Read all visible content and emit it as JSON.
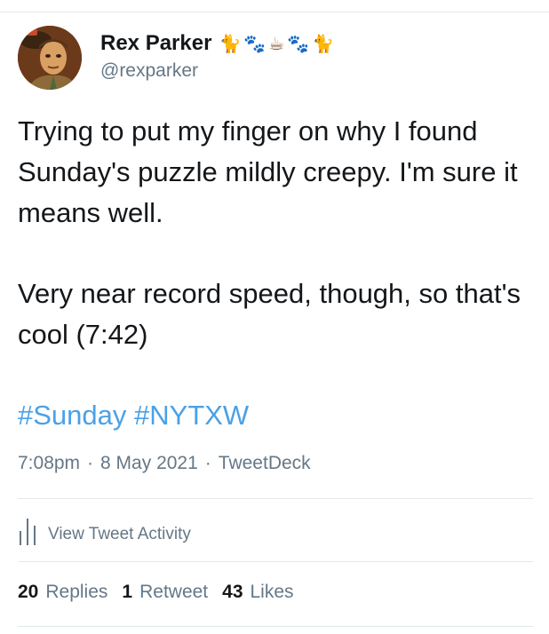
{
  "user": {
    "display_name": "Rex Parker",
    "handle": "@rexparker",
    "name_emojis": [
      "🐈",
      "🐾",
      "☕",
      "🐾",
      "🐈"
    ]
  },
  "tweet": {
    "paragraphs": [
      "Trying to put my finger on why I found Sunday's puzzle mildly creepy. I'm sure it means well.",
      "Very near record speed, though, so that's cool (7:42)"
    ],
    "hashtags": [
      "#Sunday",
      "#NYTXW"
    ],
    "time": "7:08pm",
    "date": "8 May 2021",
    "source": "TweetDeck",
    "separator": "·"
  },
  "activity": {
    "label": "View Tweet Activity"
  },
  "stats": {
    "replies_count": "20",
    "replies_label": "Replies",
    "retweets_count": "1",
    "retweets_label": "Retweet",
    "likes_count": "43",
    "likes_label": "Likes"
  },
  "colors": {
    "text": "#14171a",
    "secondary": "#657786",
    "link": "#4ba1e6",
    "divider": "#e1e8ed"
  }
}
